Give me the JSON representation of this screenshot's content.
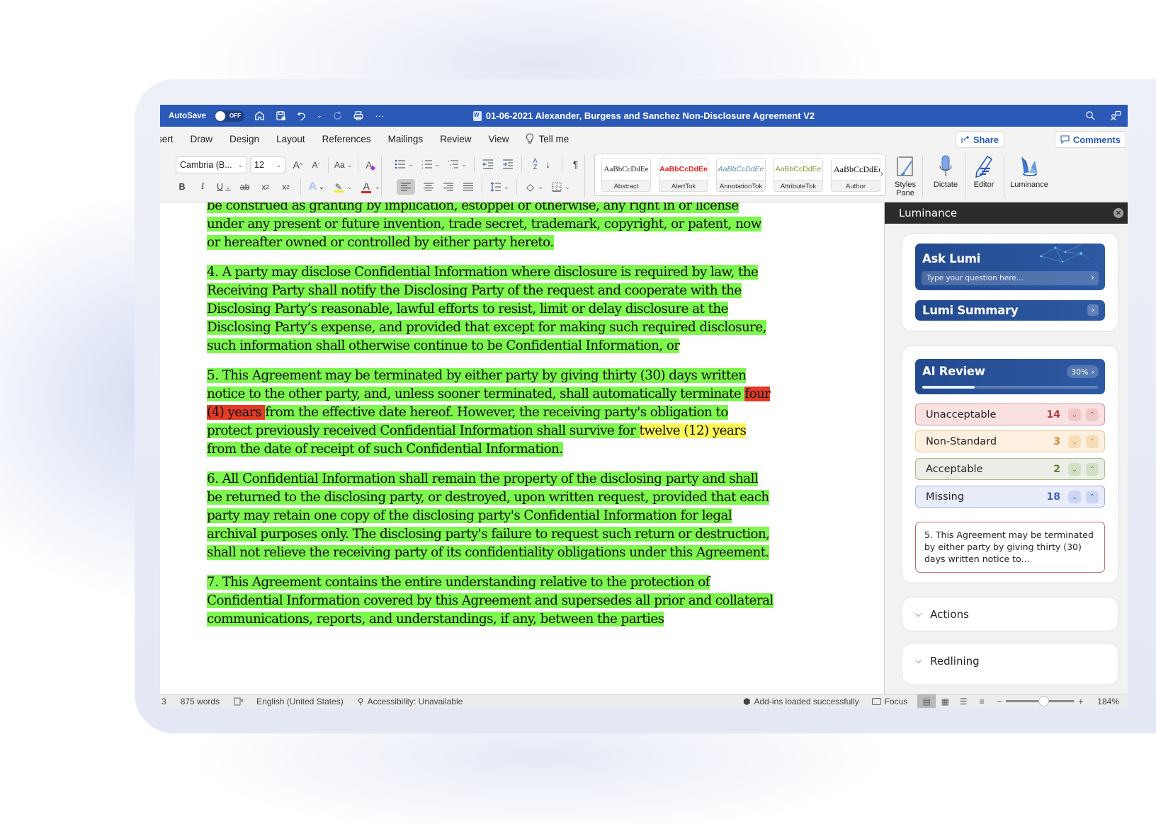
{
  "titlebar": {
    "autosave_label": "AutoSave",
    "autosave_state": "OFF",
    "document_title": "01-06-2021 Alexander, Burgess and Sanchez Non-Disclosure Agreement V2",
    "icons": [
      "home-icon",
      "save-icon",
      "undo-icon",
      "redo-icon",
      "print-icon",
      "more-icon",
      "search-icon",
      "collaborate-icon"
    ]
  },
  "tabs": [
    {
      "label": "Insert",
      "visible_label": "sert"
    },
    {
      "label": "Draw"
    },
    {
      "label": "Design"
    },
    {
      "label": "Layout"
    },
    {
      "label": "References"
    },
    {
      "label": "Mailings"
    },
    {
      "label": "Review"
    },
    {
      "label": "View"
    }
  ],
  "tell_me": "Tell me",
  "share_label": "Share",
  "comments_label": "Comments",
  "ribbon": {
    "font_name": "Cambria (B...",
    "font_size": "12",
    "change_case": "Aa",
    "styles": [
      {
        "sample": "AaBbCcDdEe",
        "name": "Abstract",
        "color": "#222222"
      },
      {
        "sample": "AaBbCcDdEe",
        "name": "AlertTok",
        "color": "#e02020"
      },
      {
        "sample": "AaBbCcDdEe",
        "name": "AnnotationTok",
        "color": "#5a8fa8"
      },
      {
        "sample": "AaBbCcDdEe",
        "name": "AttributeTok",
        "color": "#7a9a2a"
      },
      {
        "sample": "AaBbCcDdEe",
        "name": "Author",
        "color": "#111111"
      }
    ],
    "styles_pane_label": "Styles Pane",
    "dictate_label": "Dictate",
    "editor_label": "Editor",
    "luminance_label": "Luminance",
    "highlight_color": "#f6e72c",
    "font_color": "#d9261c"
  },
  "document": {
    "paragraphs": [
      {
        "segments": [
          {
            "text": "be construed as granting by implication, estoppel or otherwise, any right in or license under any present or future invention, trade secret, trademark, copyright, or patent, now or hereafter owned or controlled by either party hereto.",
            "hl": "green"
          }
        ]
      },
      {
        "segments": [
          {
            "text": "4. A party may disclose Confidential Information where disclosure is required by law, the Receiving Party shall notify the Disclosing Party of the request and cooperate with the Disclosing Party’s reasonable, lawful efforts to resist, limit or delay disclosure at the Disclosing Party’s expense, and provided that except for making such required disclosure, such information shall otherwise continue to be Confidential Information, or",
            "hl": "green"
          }
        ]
      },
      {
        "segments": [
          {
            "text": "5. This Agreement may be terminated by either party by giving thirty (30) days written notice to the other party, and, unless sooner terminated, shall automatically terminate ",
            "hl": "green"
          },
          {
            "text": "four (4) years ",
            "hl": "red"
          },
          {
            "text": "from the effective date hereof. However, the receiving party's obligation to protect previously received Confidential Information shall survive for ",
            "hl": "green"
          },
          {
            "text": "twelve (12) years ",
            "hl": "yellow"
          },
          {
            "text": "from the date of receipt of such Confidential Information.",
            "hl": "green"
          }
        ]
      },
      {
        "segments": [
          {
            "text": "6. All Confidential Information shall remain the property of the disclosing party and shall be returned to the disclosing party, or destroyed, upon written request, provided that each party may retain one copy of the disclosing party's Confidential Information for legal archival purposes only. The disclosing party's failure to request such return or destruction, shall not relieve the receiving party of its confidentiality obligations under this Agreement.",
            "hl": "green"
          }
        ]
      },
      {
        "segments": [
          {
            "text": "7. This Agreement contains the entire understanding relative to the protection of Confidential Information covered by this Agreement and supersedes all prior and collateral communications, reports, and understandings, if any, between the parties",
            "hl": "green"
          }
        ]
      }
    ],
    "highlight_colors": {
      "green": "#7ef74f",
      "red": "#e33b26",
      "yellow": "#fcf756"
    }
  },
  "pane": {
    "title": "Luminance",
    "ask_lumi": {
      "title": "Ask Lumi",
      "placeholder": "Type your question here..."
    },
    "lumi_summary": {
      "title": "Lumi Summary"
    },
    "ai_review": {
      "title": "AI Review",
      "progress_percent": 30,
      "progress_label": "30%"
    },
    "categories": [
      {
        "label": "Unacceptable",
        "count": "14",
        "color": "#b83a3a",
        "bg": "#f9e1e1",
        "border": "#d49494",
        "btn": "#f0c8c8"
      },
      {
        "label": "Non-Standard",
        "count": "3",
        "color": "#d08a30",
        "bg": "#fdf0e0",
        "border": "#efc893",
        "btn": "#f6dcb7"
      },
      {
        "label": "Acceptable",
        "count": "2",
        "color": "#5f7e33",
        "bg": "#ebeee6",
        "border": "#a9bb8a",
        "btn": "#d3dfc4"
      },
      {
        "label": "Missing",
        "count": "18",
        "color": "#3e62c4",
        "bg": "#e9edfa",
        "border": "#9db0e3",
        "btn": "#ccd6f4"
      }
    ],
    "excerpt": "5. This Agreement may be terminated by either party by giving thirty (30) days written notice to...",
    "sections": [
      {
        "label": "Actions"
      },
      {
        "label": "Redlining"
      }
    ]
  },
  "statusbar": {
    "page": "3",
    "words": "875 words",
    "language": "English (United States)",
    "accessibility": "Accessibility: Unavailable",
    "addins": "Add-ins loaded successfully",
    "focus": "Focus",
    "zoom_label": "184%",
    "zoom_slider_fraction": 0.55
  }
}
